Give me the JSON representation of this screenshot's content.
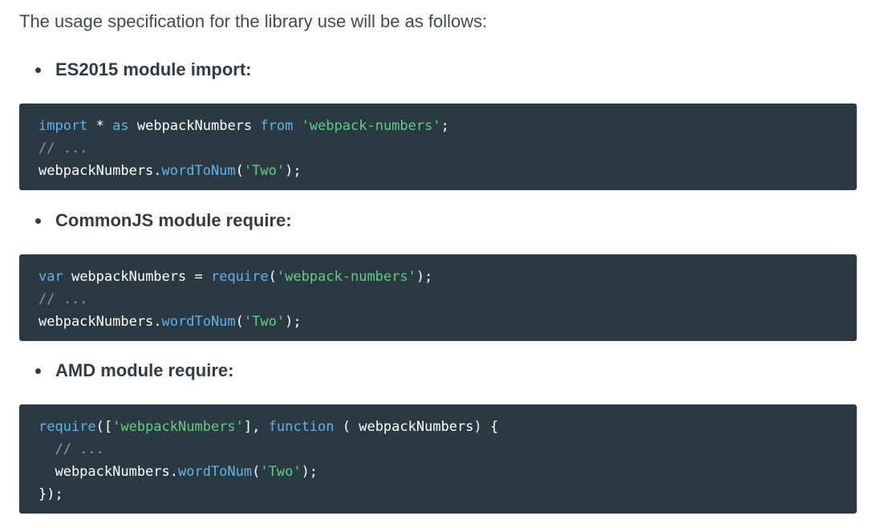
{
  "intro": "The usage specification for the library use will be as follows:",
  "sections": [
    {
      "heading": "ES2015 module import:",
      "code": {
        "l1": [
          "import",
          " * ",
          "as",
          " webpackNumbers ",
          "from",
          " ",
          "'webpack-numbers'",
          ";"
        ],
        "l2": "// ...",
        "l3": [
          "webpackNumbers.",
          "wordToNum",
          "(",
          "'Two'",
          ");"
        ]
      }
    },
    {
      "heading": "CommonJS module require:",
      "code": {
        "l1": [
          "var",
          " webpackNumbers = ",
          "require",
          "(",
          "'webpack-numbers'",
          ");"
        ],
        "l2": "// ...",
        "l3": [
          "webpackNumbers.",
          "wordToNum",
          "(",
          "'Two'",
          ");"
        ]
      }
    },
    {
      "heading": "AMD module require:",
      "code": {
        "l1": [
          "require",
          "([",
          "'webpackNumbers'",
          "], ",
          "function",
          " ( webpackNumbers) {"
        ],
        "l2": "  // ...",
        "l3": [
          "  webpackNumbers.",
          "wordToNum",
          "(",
          "'Two'",
          ");"
        ],
        "l4": "});"
      }
    }
  ],
  "colors": {
    "code_bg": "#2b3a42",
    "keyword": "#5fb3e8",
    "string": "#5ecf84",
    "comment": "#8d99a3",
    "text": "#ffffff"
  }
}
